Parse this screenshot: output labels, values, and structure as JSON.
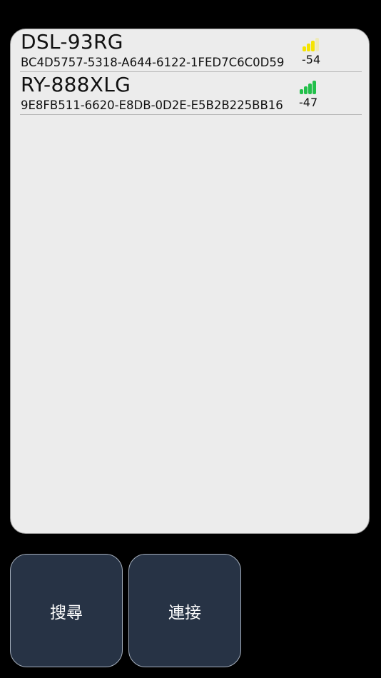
{
  "devices": [
    {
      "name": "DSL-93RG",
      "uuid": "BC4D5757-5318-A644-6122-1FED7C6C0D59",
      "rssi": "-54",
      "signal_icon": "signal-strength-icon",
      "signal_color": "#f5e400",
      "signal_active_bars": 3,
      "signal_total_bars": 4
    },
    {
      "name": "RY-888XLG",
      "uuid": "9E8FB511-6620-E8DB-0D2E-E5B2B225BB16",
      "rssi": "-47",
      "signal_icon": "signal-strength-icon",
      "signal_color": "#22c04a",
      "signal_active_bars": 4,
      "signal_total_bars": 4
    }
  ],
  "buttons": {
    "search_label": "搜尋",
    "connect_label": "連接"
  },
  "colors": {
    "background": "#000000",
    "panel": "#ececec",
    "button": "#273345"
  }
}
